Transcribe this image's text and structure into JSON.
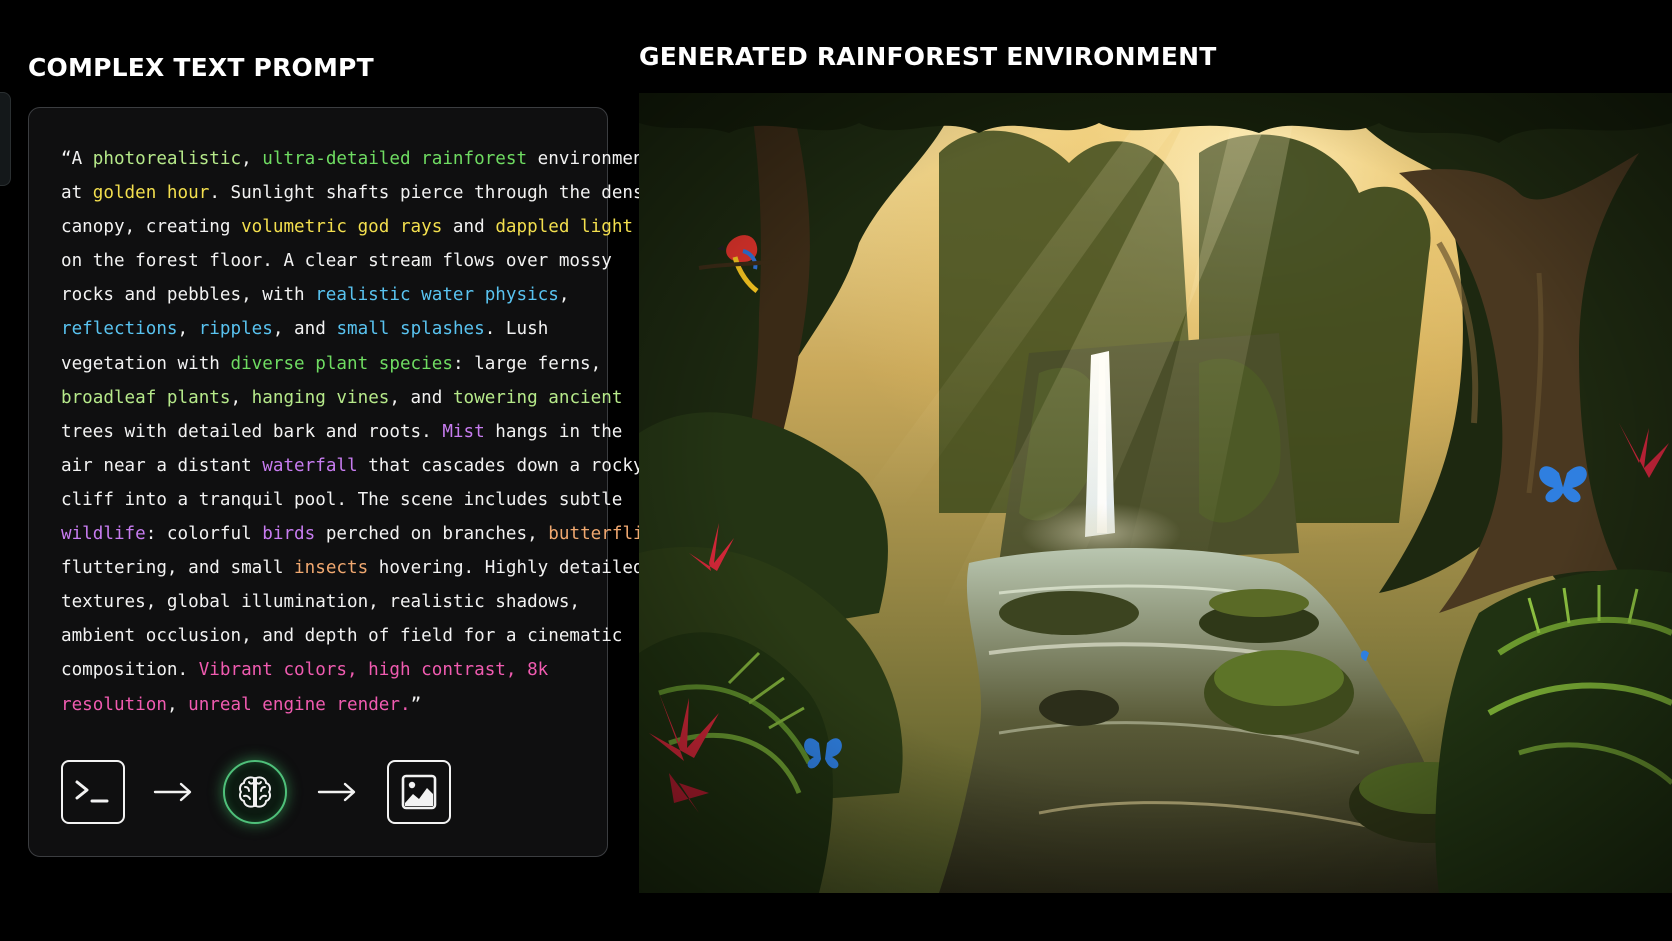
{
  "left_title": "COMPLEX TEXT PROMPT",
  "right_title": "GENERATED RAINFOREST ENVIRONMENT",
  "colors": {
    "plain": "#f2f2f2",
    "green": "#6fdc62",
    "lime": "#b6e98a",
    "yellow": "#f3df4e",
    "blue": "#59c3f0",
    "purple": "#c77cf0",
    "orange": "#f0a870",
    "pink": "#f05bb0"
  },
  "prompt_lines": [
    [
      {
        "t": "“A ",
        "c": "plain"
      },
      {
        "t": "photorealistic",
        "c": "lime"
      },
      {
        "t": ", ",
        "c": "plain"
      },
      {
        "t": "ultra-detailed rainforest",
        "c": "green"
      },
      {
        "t": " environment",
        "c": "plain"
      }
    ],
    [
      {
        "t": "at ",
        "c": "plain"
      },
      {
        "t": "golden hour",
        "c": "yellow"
      },
      {
        "t": ". Sunlight shafts pierce through the dense",
        "c": "plain"
      }
    ],
    [
      {
        "t": "canopy, creating ",
        "c": "plain"
      },
      {
        "t": "volumetric god rays",
        "c": "yellow"
      },
      {
        "t": " and ",
        "c": "plain"
      },
      {
        "t": "dappled light",
        "c": "yellow"
      }
    ],
    [
      {
        "t": "on the forest floor. A clear stream flows over mossy",
        "c": "plain"
      }
    ],
    [
      {
        "t": "rocks and pebbles, with ",
        "c": "plain"
      },
      {
        "t": "realistic water physics",
        "c": "blue"
      },
      {
        "t": ",",
        "c": "plain"
      }
    ],
    [
      {
        "t": "reflections",
        "c": "blue"
      },
      {
        "t": ", ",
        "c": "plain"
      },
      {
        "t": "ripples",
        "c": "blue"
      },
      {
        "t": ", and ",
        "c": "plain"
      },
      {
        "t": "small splashes",
        "c": "blue"
      },
      {
        "t": ". Lush",
        "c": "plain"
      }
    ],
    [
      {
        "t": "vegetation with ",
        "c": "plain"
      },
      {
        "t": "diverse plant species",
        "c": "green"
      },
      {
        "t": ": large ferns,",
        "c": "plain"
      }
    ],
    [
      {
        "t": "broadleaf plants",
        "c": "lime"
      },
      {
        "t": ", ",
        "c": "plain"
      },
      {
        "t": "hanging vines",
        "c": "lime"
      },
      {
        "t": ", and ",
        "c": "plain"
      },
      {
        "t": "towering ancient",
        "c": "lime"
      }
    ],
    [
      {
        "t": "trees with detailed bark and roots. ",
        "c": "plain"
      },
      {
        "t": "Mist",
        "c": "purple"
      },
      {
        "t": " hangs in the",
        "c": "plain"
      }
    ],
    [
      {
        "t": "air near a distant ",
        "c": "plain"
      },
      {
        "t": "waterfall",
        "c": "purple"
      },
      {
        "t": " that cascades down a rocky",
        "c": "plain"
      }
    ],
    [
      {
        "t": "cliff into a tranquil pool. The scene includes subtle",
        "c": "plain"
      }
    ],
    [
      {
        "t": "wildlife",
        "c": "purple"
      },
      {
        "t": ": colorful ",
        "c": "plain"
      },
      {
        "t": "birds",
        "c": "purple"
      },
      {
        "t": " perched on branches, ",
        "c": "plain"
      },
      {
        "t": "butterflies",
        "c": "orange"
      }
    ],
    [
      {
        "t": "fluttering, and small ",
        "c": "plain"
      },
      {
        "t": "insects",
        "c": "orange"
      },
      {
        "t": " hovering. Highly detailed",
        "c": "plain"
      }
    ],
    [
      {
        "t": "textures, global illumination, realistic shadows,",
        "c": "plain"
      }
    ],
    [
      {
        "t": "ambient occlusion, and depth of field for a cinematic",
        "c": "plain"
      }
    ],
    [
      {
        "t": "composition. ",
        "c": "plain"
      },
      {
        "t": "Vibrant colors, high contrast, 8k",
        "c": "pink"
      }
    ],
    [
      {
        "t": "resolution",
        "c": "pink"
      },
      {
        "t": ", ",
        "c": "plain"
      },
      {
        "t": "unreal engine render.",
        "c": "pink"
      },
      {
        "t": "”",
        "c": "plain"
      }
    ]
  ],
  "pipeline": [
    {
      "icon": "terminal-icon",
      "kind": "box"
    },
    {
      "icon": "arrow-right-icon",
      "kind": "arrow"
    },
    {
      "icon": "brain-icon",
      "kind": "circle"
    },
    {
      "icon": "arrow-right-icon",
      "kind": "arrow"
    },
    {
      "icon": "image-chart-icon",
      "kind": "box"
    }
  ],
  "scene": {
    "subject": "rainforest-waterfall-image",
    "palette": {
      "canopy": "#1f2a12",
      "light": "#f5d98a",
      "water": "#cfe4ea",
      "moss": "#3f5a1c",
      "flower": "#d8283a",
      "butterfly": "#2f7fe0",
      "bird_red": "#d8322a",
      "bird_yellow": "#f0c020"
    }
  }
}
